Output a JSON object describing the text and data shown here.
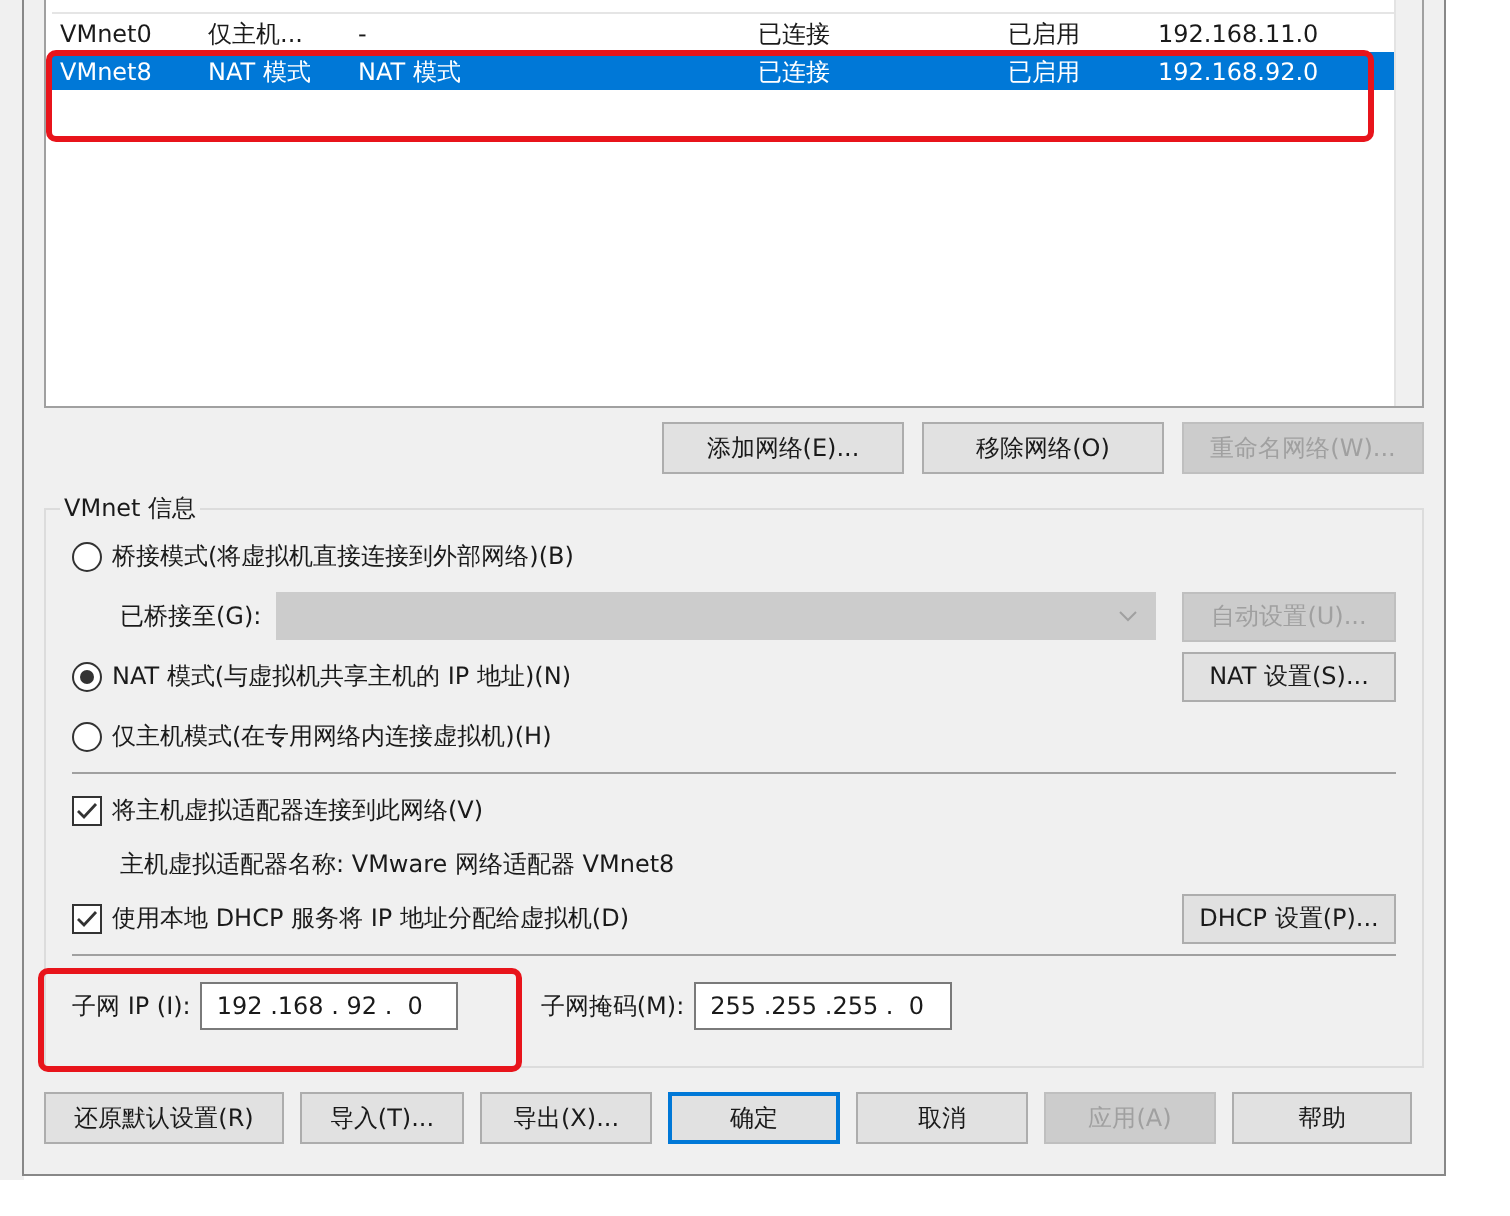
{
  "networks": {
    "rows": [
      {
        "cells": [
          "VMnet0",
          "仅主机...",
          "-",
          "已连接",
          "已启用",
          "192.168.11.0"
        ],
        "selected": false
      },
      {
        "cells": [
          "VMnet8",
          "NAT 模式",
          "NAT 模式",
          "已连接",
          "已启用",
          "192.168.92.0"
        ],
        "selected": true
      }
    ]
  },
  "network_buttons": [
    {
      "label": "添加网络(E)...",
      "disabled": false
    },
    {
      "label": "移除网络(O)",
      "disabled": false
    },
    {
      "label": "重命名网络(W)...",
      "disabled": true
    }
  ],
  "vmnet_info": {
    "title": "VMnet 信息",
    "modes": [
      {
        "label": "桥接模式(将虚拟机直接连接到外部网络)(B)",
        "selected": false
      },
      {
        "label": "NAT 模式(与虚拟机共享主机的 IP 地址)(N)",
        "selected": true
      },
      {
        "label": "仅主机模式(在专用网络内连接虚拟机)(H)",
        "selected": false
      }
    ],
    "bridged_to": {
      "label": "已桥接至(G):",
      "disabled": true
    },
    "auto_button": {
      "label": "自动设置(U)...",
      "disabled": true
    },
    "nat_button": {
      "label": "NAT 设置(S)...",
      "disabled": false
    },
    "connect_adapter": {
      "label": "将主机虚拟适配器连接到此网络(V)",
      "checked": true
    },
    "adapter_name": "主机虚拟适配器名称: VMware 网络适配器 VMnet8",
    "use_dhcp": {
      "label": "使用本地 DHCP 服务将 IP 地址分配给虚拟机(D)",
      "checked": true
    },
    "dhcp_button": {
      "label": "DHCP 设置(P)...",
      "disabled": false
    },
    "subnet_ip": {
      "label": "子网 IP (I):",
      "value": "192 .168 . 92 .  0"
    },
    "subnet_mask": {
      "label": "子网掩码(M):",
      "value": "255 .255 .255 .  0"
    }
  },
  "footer_buttons": [
    {
      "label": "还原默认设置(R)",
      "disabled": false,
      "default": false
    },
    {
      "label": "导入(T)...",
      "disabled": false,
      "default": false
    },
    {
      "label": "导出(X)...",
      "disabled": false,
      "default": false
    },
    {
      "label": "确定",
      "disabled": false,
      "default": true
    },
    {
      "label": "取消",
      "disabled": false,
      "default": false
    },
    {
      "label": "应用(A)",
      "disabled": true,
      "default": false
    },
    {
      "label": "帮助",
      "disabled": false,
      "default": false
    }
  ]
}
